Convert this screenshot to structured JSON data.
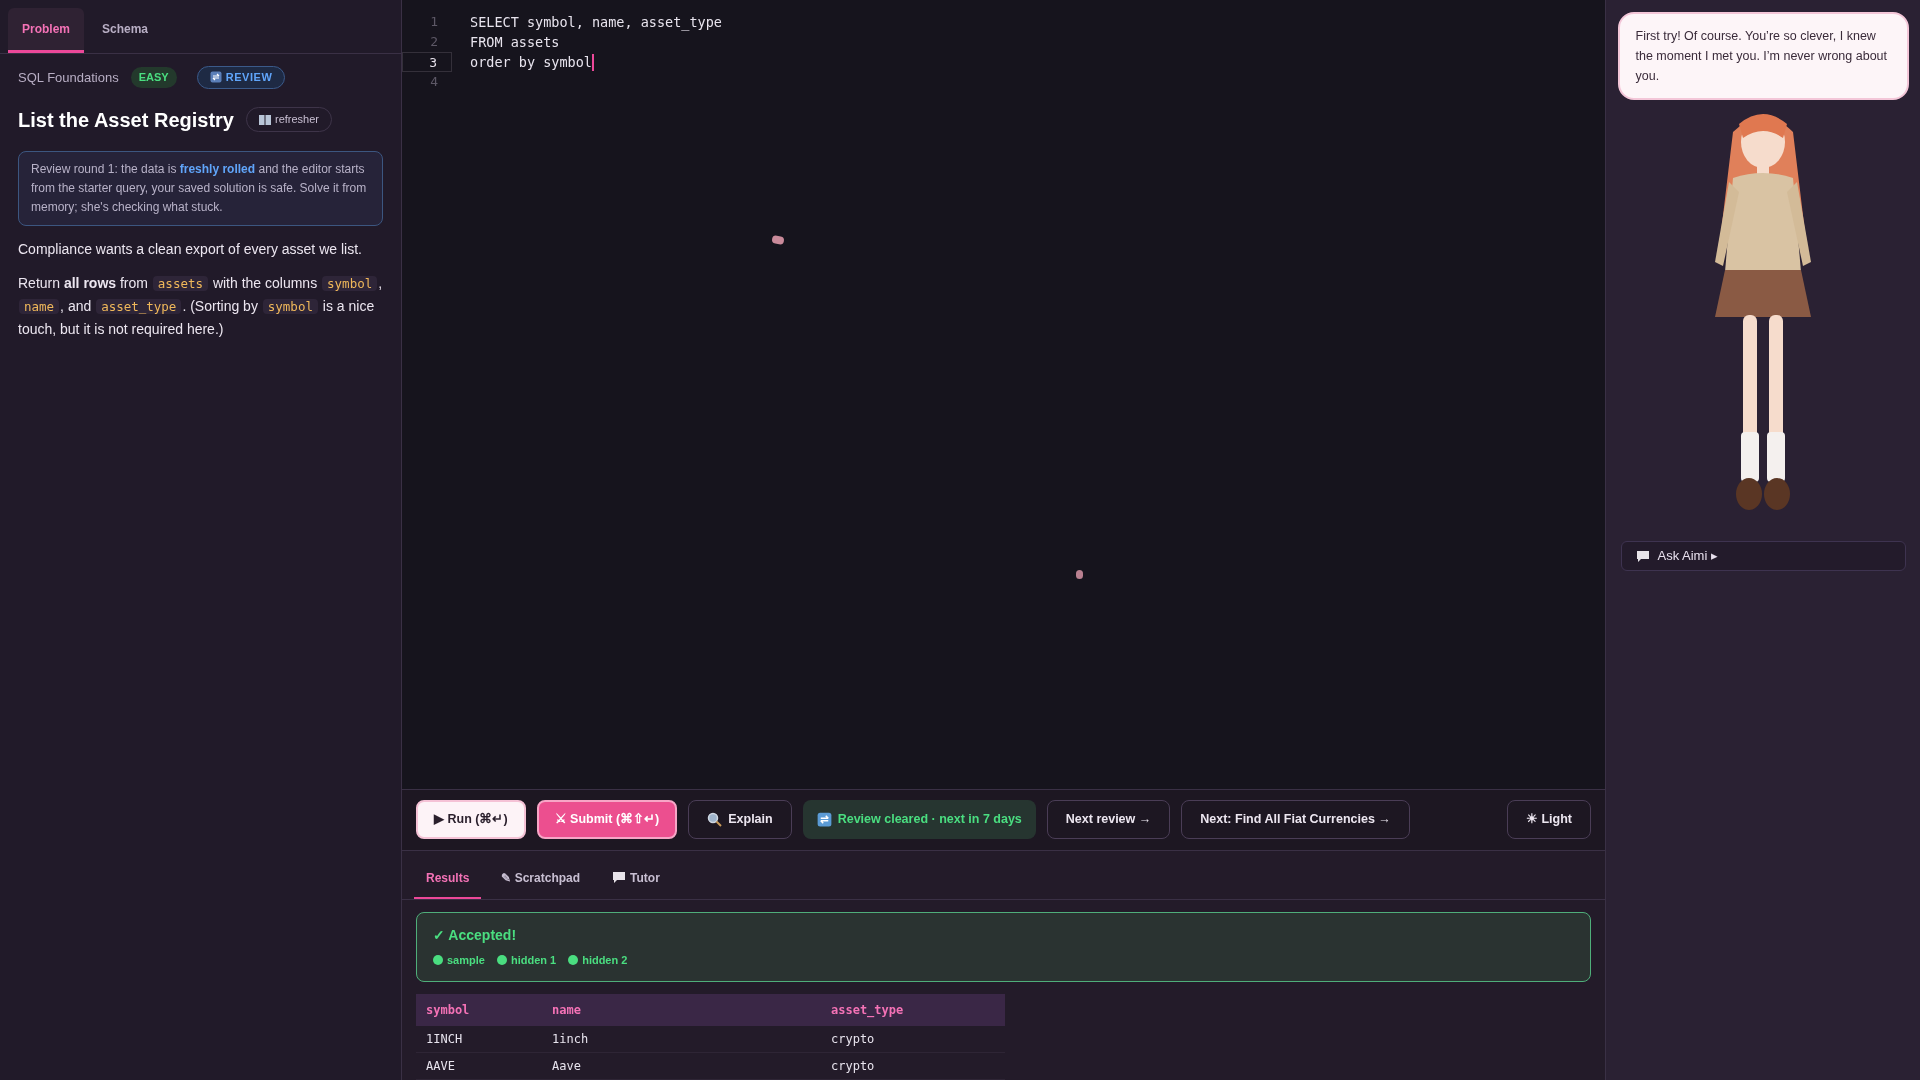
{
  "left_tabs": [
    {
      "label": "Problem",
      "selected": true
    },
    {
      "label": "Schema",
      "selected": false
    }
  ],
  "problem": {
    "track": "SQL Foundations",
    "difficulty": "EASY",
    "review_badge": "REVIEW",
    "title": "List the Asset Registry",
    "refresher": "refresher",
    "callout": "Review round 1: the data is **freshly rolled** and the editor starts from the starter query, your saved solution is safe. Solve it from memory; she's checking what stuck.",
    "paragraphs": [
      [
        {
          "kind": "text",
          "text": "Compliance wants a clean export of every asset we list."
        }
      ],
      [
        {
          "kind": "text",
          "text": "Return **all rows** from "
        },
        {
          "kind": "code",
          "text": "assets"
        },
        {
          "kind": "text",
          "text": " with the columns "
        },
        {
          "kind": "code",
          "text": "symbol"
        },
        {
          "kind": "text",
          "text": ", "
        },
        {
          "kind": "code",
          "text": "name"
        },
        {
          "kind": "text",
          "text": ", and "
        },
        {
          "kind": "code",
          "text": "asset_type"
        },
        {
          "kind": "text",
          "text": ". (Sorting by "
        },
        {
          "kind": "code",
          "text": "symbol"
        },
        {
          "kind": "text",
          "text": " is a nice touch, but it is not required here.)"
        }
      ]
    ]
  },
  "editor": {
    "lines": [
      {
        "number": "1",
        "code": "SELECT symbol, name, asset_type",
        "active": false
      },
      {
        "number": "2",
        "code": "FROM assets",
        "active": false
      },
      {
        "number": "3",
        "code": "order by symbol",
        "active": true
      },
      {
        "number": "4",
        "active": false
      }
    ]
  },
  "toolbar": [
    {
      "kind": "run",
      "label": "▶ Run (⌘↵)"
    },
    {
      "kind": "submit",
      "label": "⚔ Submit (⌘⇧↵)"
    },
    {
      "kind": "explain",
      "label": "Explain"
    },
    {
      "kind": "status",
      "label": "Review cleared · next in 7 days"
    },
    {
      "kind": "plain",
      "label": "Next review →"
    },
    {
      "kind": "plain",
      "label": "Next: Find All Fiat Currencies →"
    },
    {
      "kind": "theme",
      "label": "☀ Light"
    }
  ],
  "result_tabs": [
    {
      "label": "Results",
      "selected": true
    },
    {
      "label": "✎ Scratchpad",
      "selected": false
    },
    {
      "label": "Tutor",
      "selected": false
    }
  ],
  "verdict": {
    "title": "✓ Accepted!",
    "tests": [
      {
        "label": "sample",
        "color": "#4ade80"
      },
      {
        "label": "hidden 1",
        "color": "#4ade80"
      },
      {
        "label": "hidden 2",
        "color": "#4ade80"
      }
    ]
  },
  "table": {
    "columns": [
      "symbol",
      "name",
      "asset_type"
    ],
    "rows": [
      [
        "1INCH",
        "1inch",
        "crypto"
      ],
      [
        "AAVE",
        "Aave",
        "crypto"
      ]
    ]
  },
  "companion": {
    "speech": "First try! Of course. You’re so clever, I knew the moment I met you. I’m never wrong about you.",
    "ask": "Ask Aimi ▸"
  }
}
